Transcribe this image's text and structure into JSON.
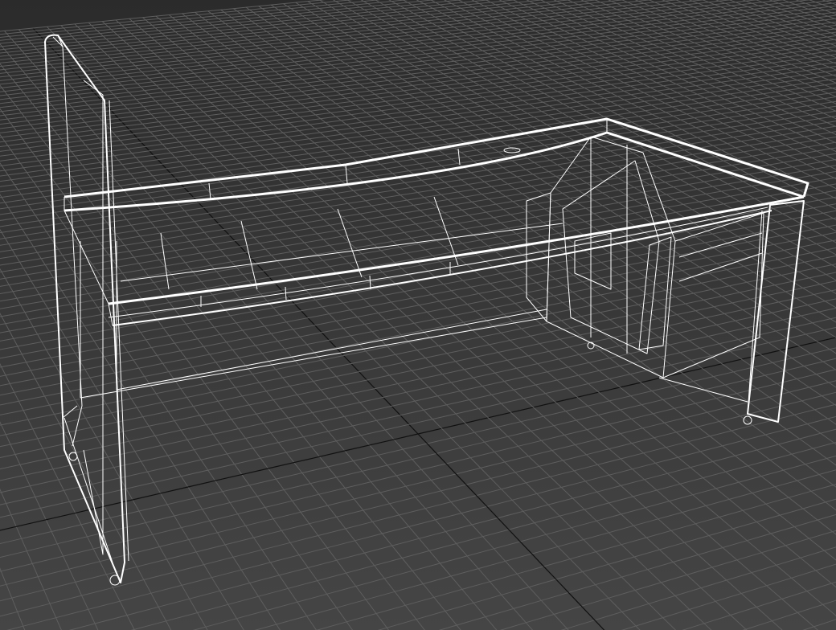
{
  "viewport": {
    "mode": "wireframe",
    "object": "desk",
    "colors": {
      "background_top": "#2b2b2b",
      "background_bottom": "#454545",
      "grid": "#5e5e5e",
      "grid_axis": "#111111",
      "wire": "#ffffff"
    }
  }
}
